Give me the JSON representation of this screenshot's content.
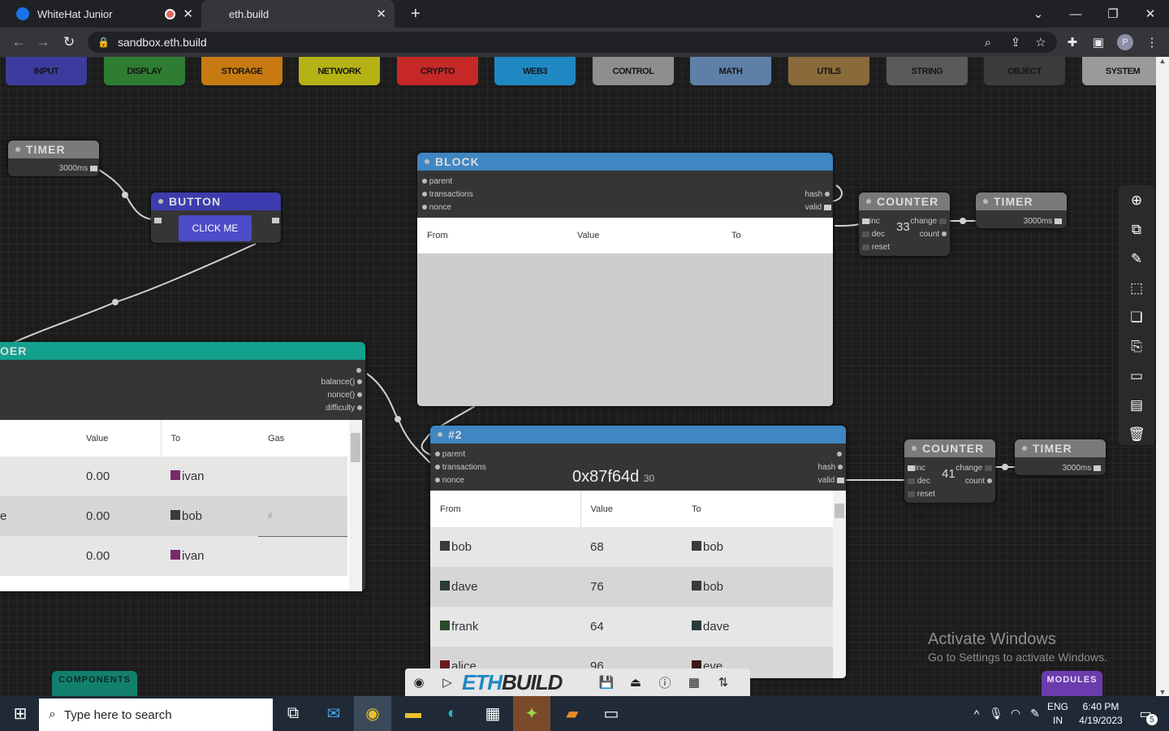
{
  "browser": {
    "tabs": [
      {
        "title": "WhiteHat Junior"
      },
      {
        "title": "eth.build"
      }
    ],
    "new_tab": "+",
    "url": "sandbox.eth.build",
    "profile": "P"
  },
  "palette": {
    "categories": [
      {
        "label": "INPUT",
        "color": "#3c3c9e"
      },
      {
        "label": "DISPLAY",
        "color": "#2e7d32"
      },
      {
        "label": "STORAGE",
        "color": "#c77a12"
      },
      {
        "label": "NETWORK",
        "color": "#b5b215"
      },
      {
        "label": "CRYPTO",
        "color": "#c62828"
      },
      {
        "label": "WEB3",
        "color": "#1f88c3"
      },
      {
        "label": "CONTROL",
        "color": "#8e8e8e"
      },
      {
        "label": "MATH",
        "color": "#5e80a8"
      },
      {
        "label": "UTILS",
        "color": "#8a6a3a"
      },
      {
        "label": "STRING",
        "color": "#5a5a5a"
      },
      {
        "label": "OBJECT",
        "color": "#3c3c3c"
      },
      {
        "label": "SYSTEM",
        "color": "#9a9a9a"
      }
    ]
  },
  "nodes": {
    "timer1": {
      "title": "TIMER",
      "interval": "3000ms"
    },
    "button": {
      "title": "BUTTON",
      "label": "CLICK ME"
    },
    "block": {
      "title": "BLOCK",
      "inputs": [
        "parent",
        "transactions",
        "nonce"
      ],
      "outputs": [
        "hash",
        "valid"
      ],
      "columns": [
        "From",
        "Value",
        "To"
      ]
    },
    "counter1": {
      "title": "COUNTER",
      "inputs": [
        "inc",
        "dec",
        "reset"
      ],
      "outputs": [
        "change",
        "count"
      ],
      "value": "33"
    },
    "timer2": {
      "title": "TIMER",
      "interval": "3000ms"
    },
    "ledger": {
      "title": "OER",
      "outputs": [
        "balance()",
        "nonce()",
        "difficulty"
      ],
      "columns": [
        "Value",
        "To",
        "Gas"
      ],
      "rows": [
        {
          "value": "0.00",
          "to": "ivan"
        },
        {
          "value": "0.00",
          "to": "bob"
        },
        {
          "value": "0.00",
          "to": "ivan"
        }
      ],
      "gas_placeholder": "#",
      "row_marker": "e"
    },
    "block2": {
      "title": "#2",
      "inputs": [
        "parent",
        "transactions",
        "nonce"
      ],
      "outputs": [
        "hash",
        "valid"
      ],
      "hash": "0x87f64d",
      "nonce": "30",
      "columns": [
        "From",
        "Value",
        "To"
      ],
      "rows": [
        {
          "from": "bob",
          "value": "68",
          "to": "bob"
        },
        {
          "from": "dave",
          "value": "76",
          "to": "bob"
        },
        {
          "from": "frank",
          "value": "64",
          "to": "dave"
        },
        {
          "from": "alice",
          "value": "96",
          "to": "eve"
        }
      ]
    },
    "counter2": {
      "title": "COUNTER",
      "inputs": [
        "inc",
        "dec",
        "reset"
      ],
      "outputs": [
        "change",
        "count"
      ],
      "value": "41"
    },
    "timer3": {
      "title": "TIMER",
      "interval": "3000ms"
    }
  },
  "bottom": {
    "components": "COMPONENTS",
    "modules": "MODULES",
    "logo_eth": "ETH",
    "logo_build": "BUILD"
  },
  "watermark": {
    "line1": "Activate Windows",
    "line2": "Go to Settings to activate Windows."
  },
  "taskbar": {
    "search_placeholder": "Type here to search",
    "lang1": "ENG",
    "lang2": "IN",
    "time": "6:40 PM",
    "date": "4/19/2023",
    "notifications": "5"
  }
}
